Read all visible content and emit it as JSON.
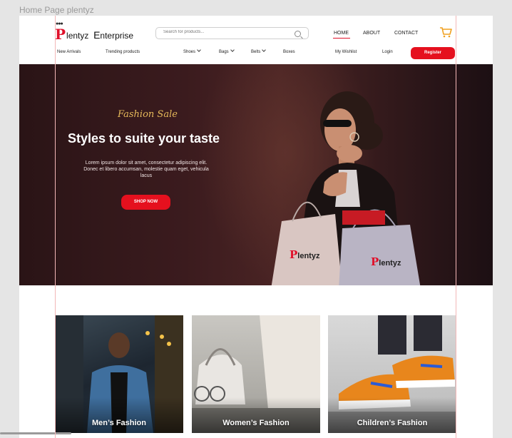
{
  "frame_label": "Home Page plentyz",
  "brand": {
    "p": "P",
    "rest": "lentyz",
    "e": "E",
    "enterprise": "nterprise"
  },
  "search": {
    "placeholder": "Search for products..."
  },
  "top_nav": {
    "home": "HOME",
    "about": "ABOUT",
    "contact": "CONTACT"
  },
  "sub_nav": {
    "new_arrivals": "New Arrivals",
    "trending": "Trending products",
    "shoes": "Shoes",
    "bags": "Bags",
    "belts": "Belts",
    "boxes": "Boxes",
    "wishlist": "My Wishlist",
    "login": "Login",
    "register": "Register"
  },
  "hero": {
    "tagline": "Fashion Sale",
    "title": "Styles to suite your taste",
    "description": "Lorem ipsum dolor sit amet, consectetur adipiscing elit. Donec et libero accumsan, molestie quam eget, vehicula lacus",
    "cta": "SHOP NOW",
    "bag_brand": "lentyz"
  },
  "categories": [
    {
      "label": "Men’s Fashion"
    },
    {
      "label": "Women’s Fashion"
    },
    {
      "label": "Children’s Fashion"
    }
  ],
  "colors": {
    "accent": "#e5101e",
    "gold": "#e6b95a",
    "hero_bg": "#3b1b1e"
  },
  "icons": [
    "search-icon",
    "cart-icon",
    "chevron-down-icon"
  ]
}
